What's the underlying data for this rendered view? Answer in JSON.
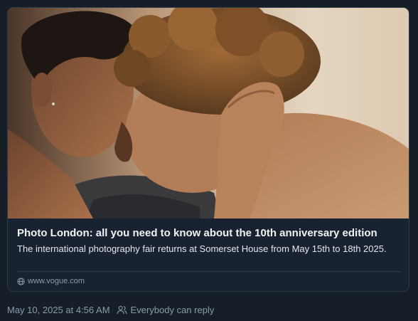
{
  "link_card": {
    "image_icon": "photo-thumbnail",
    "title": "Photo London: all you need to know about the 10th anniversary edition",
    "description": "The international photography fair returns at Somerset House from May 15th to 18th 2025.",
    "domain_icon": "globe-icon",
    "domain": "www.vogue.com"
  },
  "post_meta": {
    "timestamp": "May 10, 2025 at 4:56 AM",
    "reply_icon": "people-icon",
    "reply_setting": "Everybody can reply"
  },
  "colors": {
    "background": "#161e27",
    "card_border": "#2e3b4b",
    "title": "#f1f3f5",
    "muted": "#8c9aaa"
  }
}
